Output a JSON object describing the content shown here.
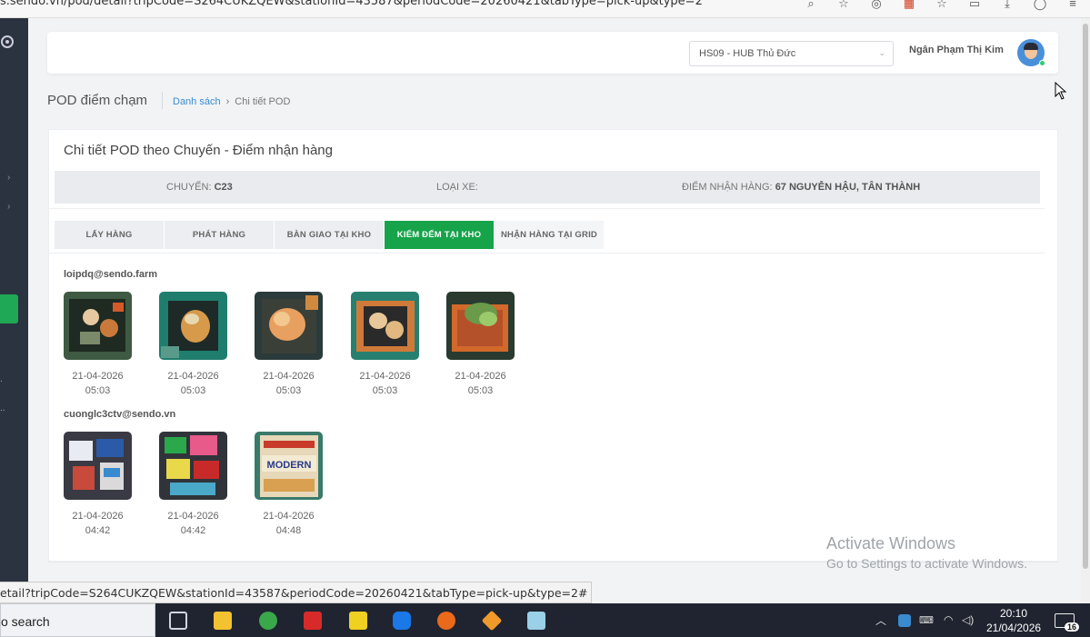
{
  "browser": {
    "url": "s.sendo.vn/pod/detail?tripCode=S264CUKZQEW&stationId=43587&periodCode=20260421&tabType=pick-up&type=2",
    "status_url": "etail?tripCode=S264CUKZQEW&stationId=43587&periodCode=20260421&tabType=pick-up&type=2#"
  },
  "header": {
    "hub_selected": "HS09 - HUB Thủ Đức",
    "user_name": "Ngân Phạm Thị Kim"
  },
  "breadcrumb": {
    "page_title": "POD điểm chạm",
    "list_link": "Danh sách",
    "separator": "›",
    "current": "Chi tiết POD"
  },
  "detail": {
    "title": "Chi tiết POD theo Chuyến - Điểm nhận hàng",
    "trip_label": "CHUYẾN:",
    "trip_value": "C23",
    "vehicle_label": "LOẠI XE:",
    "vehicle_value": "",
    "pickup_label": "ĐIỂM NHẬN HÀNG:",
    "pickup_value": "67 NGUYỄN HẬU, TÂN THÀNH"
  },
  "tabs": [
    {
      "label": "LẤY HÀNG",
      "active": false
    },
    {
      "label": "PHÁT HÀNG",
      "active": false
    },
    {
      "label": "BÀN GIAO TẠI KHO",
      "active": false
    },
    {
      "label": "KIỂM ĐẾM TẠI KHO",
      "active": true
    },
    {
      "label": "NHẬN HÀNG TẠI GRID",
      "active": false
    }
  ],
  "groups": [
    {
      "user": "loipdq@sendo.farm",
      "photos": [
        {
          "date": "21-04-2026",
          "time": "05:03"
        },
        {
          "date": "21-04-2026",
          "time": "05:03"
        },
        {
          "date": "21-04-2026",
          "time": "05:03"
        },
        {
          "date": "21-04-2026",
          "time": "05:03"
        },
        {
          "date": "21-04-2026",
          "time": "05:03"
        }
      ]
    },
    {
      "user": "cuonglc3ctv@sendo.vn",
      "photos": [
        {
          "date": "21-04-2026",
          "time": "04:42"
        },
        {
          "date": "21-04-2026",
          "time": "04:42"
        },
        {
          "date": "21-04-2026",
          "time": "04:48",
          "box_text": "MODERN"
        }
      ]
    }
  ],
  "watermark": {
    "line1": "Activate Windows",
    "line2": "Go to Settings to activate Windows."
  },
  "taskbar": {
    "search": "o search",
    "time": "20:10",
    "date": "21/04/2026",
    "notifications": "16"
  },
  "colors": {
    "accent_green": "#16a34a",
    "sidebar": "#2b3340",
    "link_blue": "#3a8cd0"
  }
}
